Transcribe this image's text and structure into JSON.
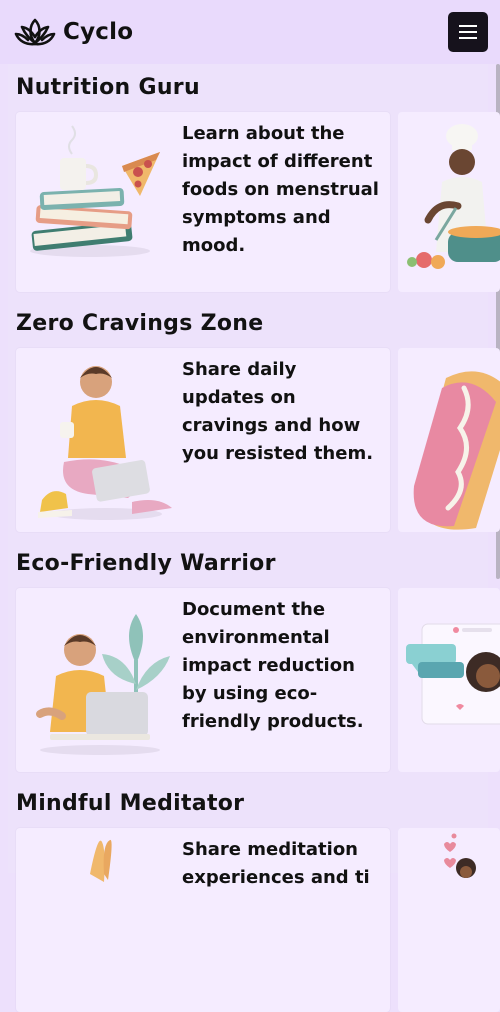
{
  "app": {
    "name": "Cyclo",
    "logo_icon": "lotus-icon",
    "menu_icon": "hamburger-menu-icon"
  },
  "sections": [
    {
      "title": "Nutrition Guru",
      "card_text": "Learn about the impact of different foods on menstrual symptoms and mood.",
      "image": "books-coffee-pizza-illustration",
      "next_card_image": "chef-cooking-illustration"
    },
    {
      "title": "Zero Cravings Zone",
      "card_text": "Share daily updates on cravings and how you resisted them.",
      "image": "person-with-laptop-illustration",
      "next_card_image": "hot-dog-illustration"
    },
    {
      "title": "Eco-Friendly Warrior",
      "card_text": "Document the environmental impact reduction by using eco-friendly products.",
      "image": "person-laptop-plant-illustration",
      "next_card_image": "social-media-chat-illustration"
    },
    {
      "title": "Mindful Meditator",
      "card_text": "Share meditation experiences and ti",
      "image": "meditation-hands-illustration",
      "next_card_image": "hearts-person-illustration"
    }
  ],
  "colors": {
    "background": "#ede0fc",
    "card": "#f5ecff",
    "menu_button": "#16121c"
  }
}
